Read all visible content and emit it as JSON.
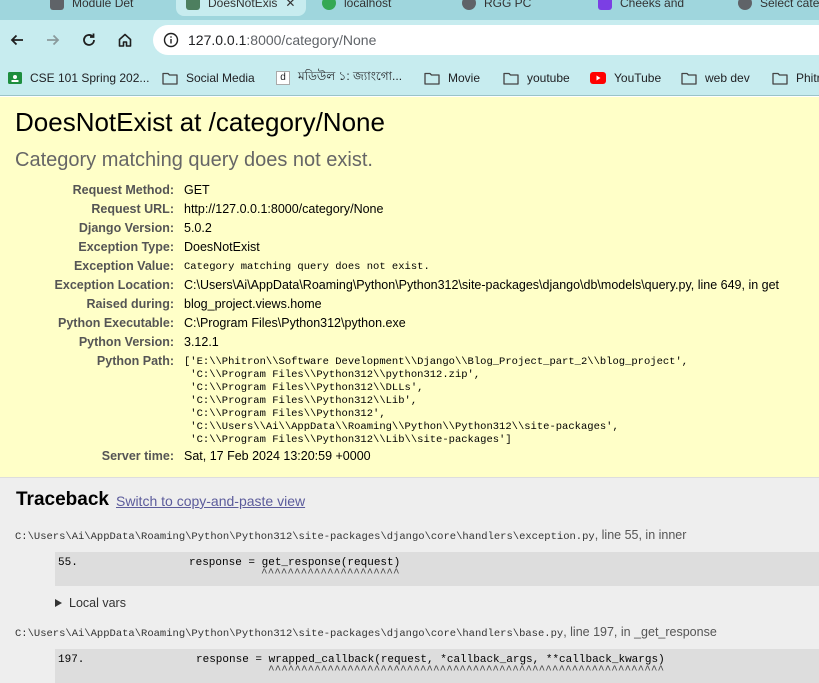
{
  "browser": {
    "tabs": [
      {
        "label": "Module Det",
        "fav_color": "#5f6368",
        "active": false
      },
      {
        "label": "DoesNotExis",
        "fav_color": "#4d7f5f",
        "active": true
      },
      {
        "label": "localhost",
        "fav_color": "#34a853",
        "active": false
      },
      {
        "label": "RGG PC",
        "fav_color": "#5f6368",
        "active": false
      },
      {
        "label": "Cheeks and",
        "fav_color": "#7b3fe4",
        "active": false
      },
      {
        "label": "Select cate",
        "fav_color": "#5f6368",
        "active": false
      }
    ],
    "url_host": "127.0.0.1",
    "url_rest": ":8000/category/None",
    "bookmarks": [
      {
        "label": "CSE 101 Spring 202...",
        "icon": "classroom-icon"
      },
      {
        "label": "Social Media",
        "icon": "folder-icon"
      },
      {
        "label": "মডিউল ১: জ্যাংগো...",
        "icon": "d-icon"
      },
      {
        "label": "Movie",
        "icon": "folder-icon"
      },
      {
        "label": "youtube",
        "icon": "folder-icon"
      },
      {
        "label": "YouTube",
        "icon": "youtube-icon"
      },
      {
        "label": "web dev",
        "icon": "folder-icon"
      },
      {
        "label": "Phitr",
        "icon": "folder-icon"
      }
    ]
  },
  "error": {
    "title": "DoesNotExist at /category/None",
    "message": "Category matching query does not exist."
  },
  "meta": {
    "request_method_key": "Request Method:",
    "request_method": "GET",
    "request_url_key": "Request URL:",
    "request_url": "http://127.0.0.1:8000/category/None",
    "django_version_key": "Django Version:",
    "django_version": "5.0.2",
    "exception_type_key": "Exception Type:",
    "exception_type": "DoesNotExist",
    "exception_value_key": "Exception Value:",
    "exception_value": "Category matching query does not exist.",
    "exception_location_key": "Exception Location:",
    "exception_location": "C:\\Users\\Ai\\AppData\\Roaming\\Python\\Python312\\site-packages\\django\\db\\models\\query.py, line 649, in get",
    "raised_during_key": "Raised during:",
    "raised_during": "blog_project.views.home",
    "python_executable_key": "Python Executable:",
    "python_executable": "C:\\Program Files\\Python312\\python.exe",
    "python_version_key": "Python Version:",
    "python_version": "3.12.1",
    "python_path_key": "Python Path:",
    "python_path": "['E:\\\\Phitron\\\\Software Development\\\\Django\\\\Blog_Project_part_2\\\\blog_project',\n 'C:\\\\Program Files\\\\Python312\\\\python312.zip',\n 'C:\\\\Program Files\\\\Python312\\\\DLLs',\n 'C:\\\\Program Files\\\\Python312\\\\Lib',\n 'C:\\\\Program Files\\\\Python312',\n 'C:\\\\Users\\\\Ai\\\\AppData\\\\Roaming\\\\Python\\\\Python312\\\\site-packages',\n 'C:\\\\Program Files\\\\Python312\\\\Lib\\\\site-packages']",
    "server_time_key": "Server time:",
    "server_time": "Sat, 17 Feb 2024 13:20:59 +0000"
  },
  "traceback": {
    "title": "Traceback",
    "switch_link": "Switch to copy-and-paste view",
    "local_vars": "Local vars",
    "frames": [
      {
        "file": "C:\\Users\\Ai\\AppData\\Roaming\\Python\\Python312\\site-packages\\django\\core\\handlers\\exception.py",
        "where": ", line 55, in inner",
        "lineno": "55.",
        "code": "response = get_response(request)",
        "carets": "^^^^^^^^^^^^^^^^^^^^^"
      },
      {
        "file": "C:\\Users\\Ai\\AppData\\Roaming\\Python\\Python312\\site-packages\\django\\core\\handlers\\base.py",
        "where": ", line 197, in _get_response",
        "lineno": "197.",
        "code": "response = wrapped_callback(request, *callback_args, **callback_kwargs)",
        "carets": "^^^^^^^^^^^^^^^^^^^^^^^^^^^^^^^^^^^^^^^^^^^^^^^^^^^^^^^^^^^^"
      }
    ]
  }
}
